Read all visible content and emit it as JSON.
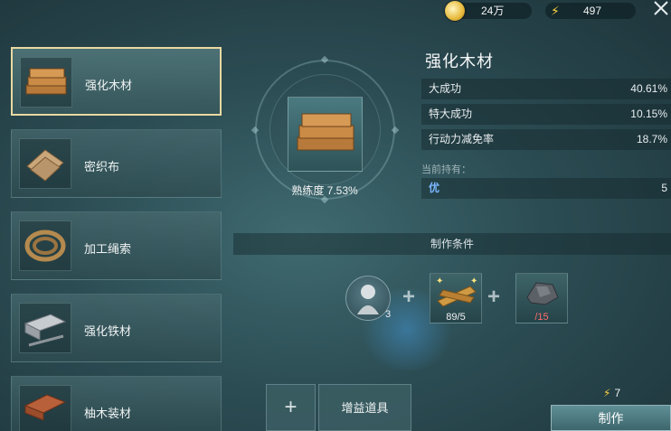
{
  "topbar": {
    "coins": "24万",
    "energy": "497"
  },
  "recipes": [
    {
      "name": "强化木材",
      "icon": "wood-planks-icon",
      "selected": true
    },
    {
      "name": "密织布",
      "icon": "cloth-icon",
      "selected": false
    },
    {
      "name": "加工绳索",
      "icon": "rope-icon",
      "selected": false
    },
    {
      "name": "强化铁材",
      "icon": "iron-ingot-icon",
      "selected": false
    },
    {
      "name": "柚木装材",
      "icon": "teak-board-icon",
      "selected": false
    }
  ],
  "detail": {
    "title": "强化木材",
    "proficiency": "熟练度 7.53%",
    "stats": [
      {
        "label": "大成功",
        "value": "40.61%"
      },
      {
        "label": "特大成功",
        "value": "10.15%"
      },
      {
        "label": "行动力减免率",
        "value": "18.7%"
      }
    ],
    "holding_label": "当前持有：",
    "holding": {
      "grade": "优",
      "count": "5"
    }
  },
  "conditions": {
    "title": "制作条件",
    "character_count": "3",
    "materials": [
      {
        "icon": "lumber-icon",
        "count": "89/5",
        "insufficient": false
      },
      {
        "icon": "ore-icon",
        "count": "/15",
        "insufficient": true
      }
    ]
  },
  "actions": {
    "add": "+",
    "buff": "增益道具",
    "energy_cost": "7",
    "craft": "制作"
  },
  "colors": {
    "accent_gold": "#e9d9a2",
    "energy": "#ffcf3f",
    "grade_blue": "#7ab7ff",
    "insufficient": "#ff6b6b"
  }
}
